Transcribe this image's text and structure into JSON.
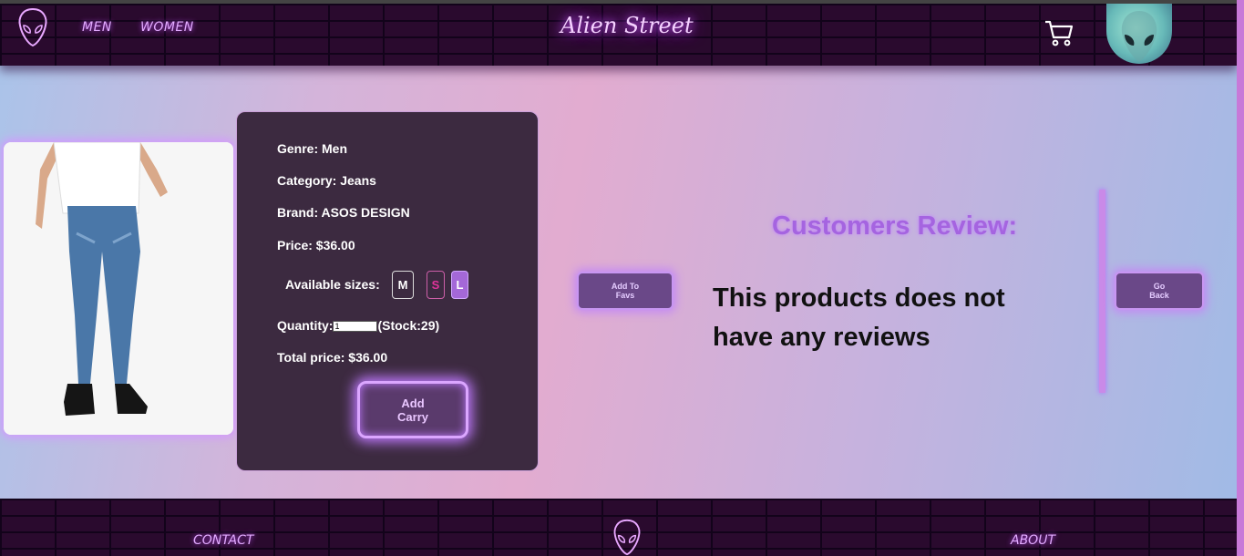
{
  "header": {
    "brand": "Alien Street",
    "nav": {
      "men": "MEN",
      "women": "WOMEN"
    },
    "icons": [
      "alien-logo-icon",
      "cart-icon",
      "alien-avatar"
    ]
  },
  "product": {
    "genre": "Genre: Men",
    "category": "Category: Jeans",
    "brand": "Brand: ASOS DESIGN",
    "price": "Price: $36.00",
    "sizes_label": "Available sizes:",
    "sizes": [
      "M",
      "S",
      "L"
    ],
    "quantity_label": "Quantity:",
    "quantity_value": "1",
    "stock": "(Stock:29)",
    "total": "Total price: $36.00",
    "add_cart_line1": "Add",
    "add_cart_line2": "Carry"
  },
  "actions": {
    "add_favs_line1": "Add To",
    "add_favs_line2": "Favs",
    "go_back_line1": "Go",
    "go_back_line2": "Back"
  },
  "reviews": {
    "title": "Customers Review:",
    "empty_text": "This products does not have any reviews"
  },
  "footer": {
    "contact": "CONTACT",
    "about": "ABOUT"
  },
  "colors": {
    "neon": "#d498ff",
    "card": "#3c2a40",
    "accent": "#a564e0"
  }
}
